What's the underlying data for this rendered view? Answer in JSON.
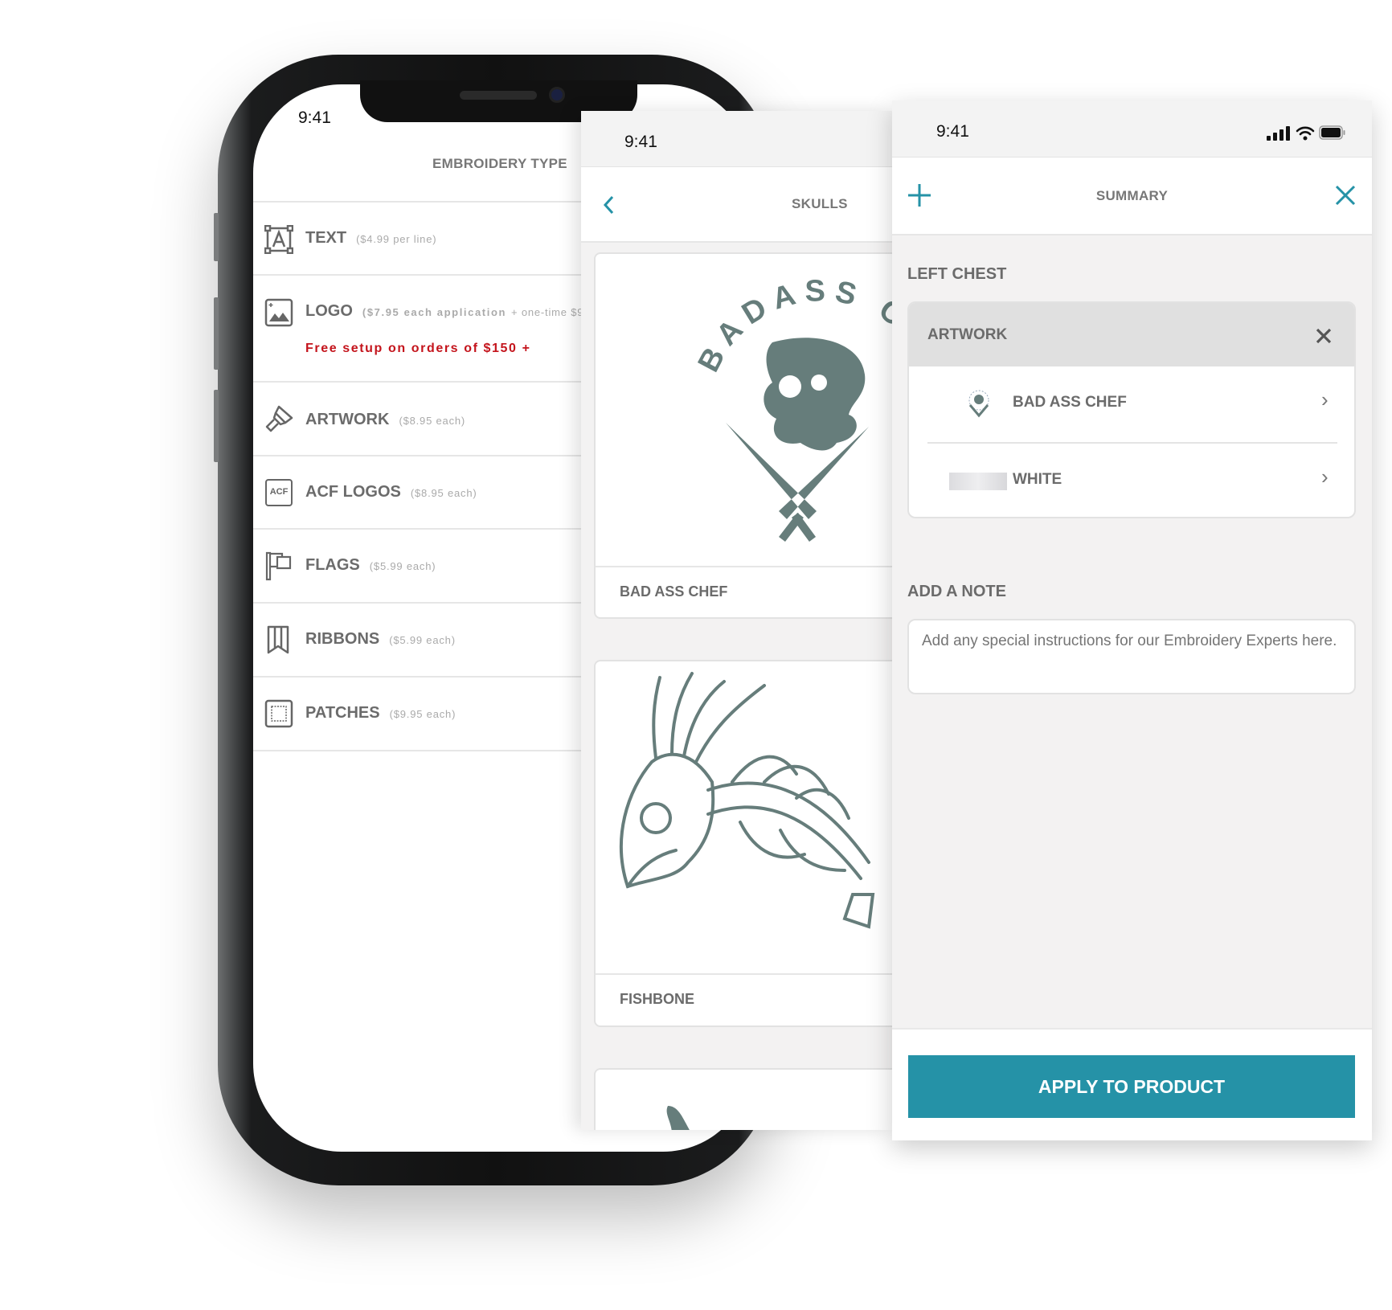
{
  "colors": {
    "accent": "#2592a7",
    "promo": "#c4141c",
    "artwork": "#667d7b"
  },
  "screen1": {
    "status_time": "9:41",
    "title": "EMBROIDERY TYPE",
    "items": [
      {
        "icon": "text-frame-icon",
        "label": "TEXT",
        "price": "($4.99 per line)"
      },
      {
        "icon": "image-icon",
        "label": "LOGO",
        "price": "($7.95 each application",
        "extra": "+ one-time $9",
        "promo": "Free setup on orders of $150 +"
      },
      {
        "icon": "paintbrush-icon",
        "label": "ARTWORK",
        "price": "($8.95 each)"
      },
      {
        "icon": "acf-badge-icon",
        "icon_text": "ACF",
        "label": "ACF LOGOS",
        "price": "($8.95 each)"
      },
      {
        "icon": "flag-icon",
        "label": "FLAGS",
        "price": "($5.99 each)"
      },
      {
        "icon": "ribbon-icon",
        "label": "RIBBONS",
        "price": "($5.99 each)"
      },
      {
        "icon": "patch-icon",
        "label": "PATCHES",
        "price": "($9.95 each)"
      }
    ]
  },
  "screen2": {
    "status_time": "9:41",
    "title": "SKULLS",
    "back_icon": "chevron-left-icon",
    "designs": [
      {
        "name": "BAD ASS CHEF",
        "logo_text": "BADASS CHEF"
      },
      {
        "name": "FISHBONE"
      }
    ]
  },
  "screen3": {
    "status_time": "9:41",
    "title": "SUMMARY",
    "add_icon": "plus-icon",
    "close_icon": "close-icon",
    "section": "LEFT CHEST",
    "artwork_card": {
      "title": "ARTWORK",
      "rows": [
        {
          "label": "BAD ASS CHEF"
        },
        {
          "label": "WHITE"
        }
      ]
    },
    "note_title": "ADD A NOTE",
    "note_placeholder": "Add any special instructions for our Embroidery Experts here.",
    "apply_label": "APPLY TO PRODUCT"
  }
}
